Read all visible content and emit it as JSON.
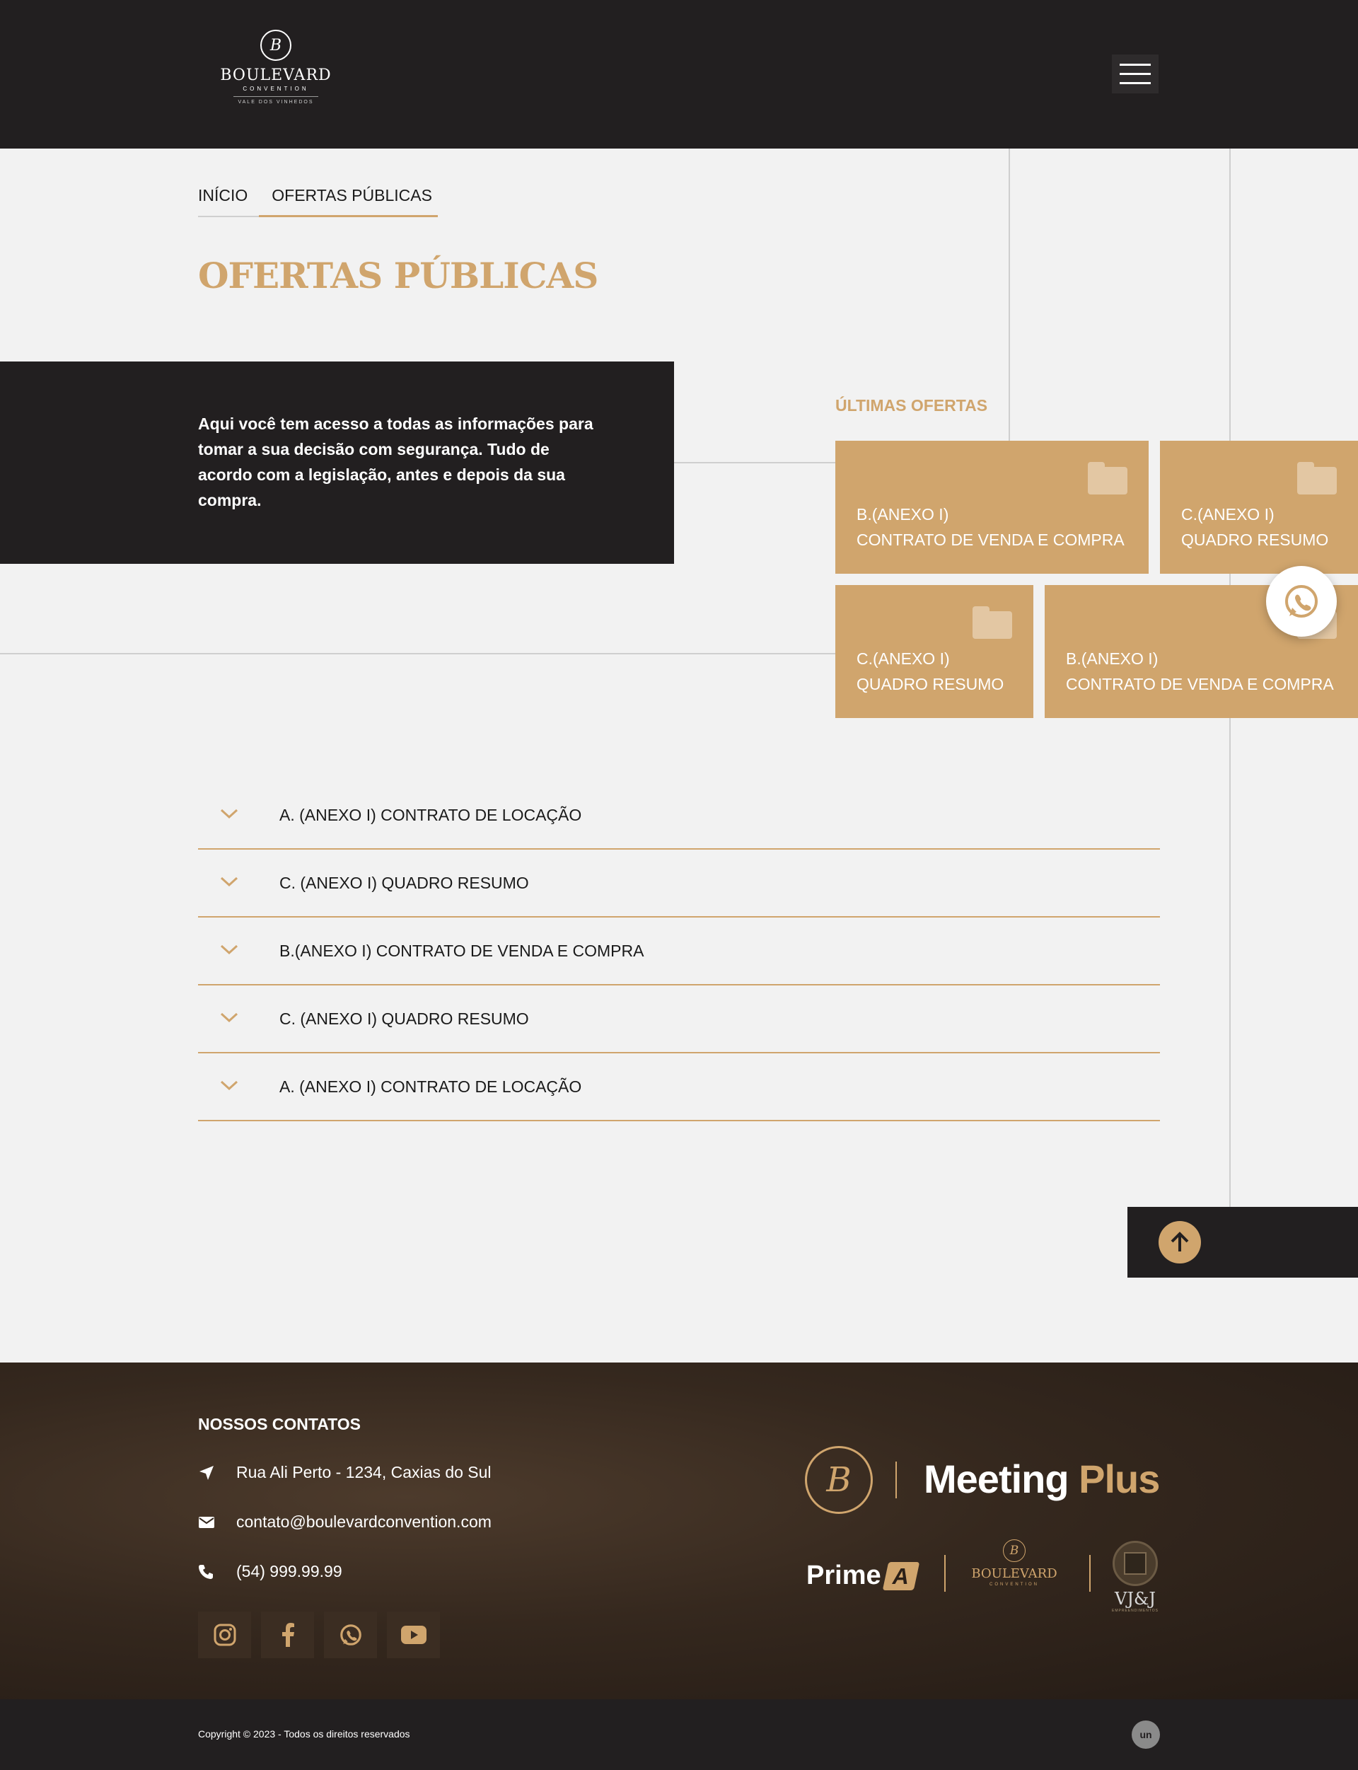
{
  "header": {
    "logo": {
      "mark": "B",
      "wordmark": "BOULEVARD",
      "subtitle": "CONVENTION",
      "tagline": "VALE DOS VINHEDOS"
    },
    "menu_icon": "hamburger-menu-icon"
  },
  "breadcrumb": {
    "home": "INÍCIO",
    "current": "OFERTAS PÚBLICAS"
  },
  "page_title": "OFERTAS PÚBLICAS",
  "intro": {
    "text": "Aqui você tem acesso a todas as informações para tomar a sua decisão com segurança. Tudo de acordo com a legislação, antes e depois da sua compra."
  },
  "latest": {
    "title": "ÚLTIMAS OFERTAS",
    "cards": [
      {
        "line1": "B.(ANEXO I)",
        "line2": "CONTRATO DE VENDA E COMPRA",
        "icon": "folder-icon"
      },
      {
        "line1": "C.(ANEXO I)",
        "line2": "QUADRO RESUMO",
        "icon": "folder-icon"
      },
      {
        "line1": "C.(ANEXO I)",
        "line2": "QUADRO RESUMO",
        "icon": "folder-icon"
      },
      {
        "line1": "B.(ANEXO I)",
        "line2": "CONTRATO DE VENDA E COMPRA",
        "icon": "folder-icon"
      }
    ]
  },
  "accordion": [
    {
      "label": "A. (ANEXO I) CONTRATO DE LOCAÇÃO"
    },
    {
      "label": "C. (ANEXO I) QUADRO RESUMO"
    },
    {
      "label": "B.(ANEXO I) CONTRATO DE VENDA E COMPRA"
    },
    {
      "label": "C. (ANEXO I) QUADRO RESUMO"
    },
    {
      "label": "A. (ANEXO I) CONTRATO DE LOCAÇÃO"
    }
  ],
  "footer": {
    "title": "NOSSOS CONTATOS",
    "address": "Rua Ali Perto - 1234, Caxias do Sul",
    "email": "contato@boulevardconvention.com",
    "phone": "(54) 999.99.99",
    "socials": [
      "instagram-icon",
      "facebook-icon",
      "whatsapp-icon",
      "youtube-icon"
    ],
    "brands": {
      "meeting": "Meeting",
      "plus": "Plus",
      "badge_mark": "B",
      "prime": "Prime",
      "prime_mark": "A",
      "boulevard_mark": "B",
      "boulevard_word": "BOULEVARD",
      "boulevard_sub": "CONVENTION",
      "vjj": "VJ&J",
      "vjj_sub": "EMPREENDIMENTOS"
    },
    "copyright": "Copyright © 2023 - Todos os direitos reservados",
    "dev_mark": "un"
  },
  "colors": {
    "accent": "#d0a56d",
    "dark": "#221f20",
    "background": "#f2f2f2"
  }
}
